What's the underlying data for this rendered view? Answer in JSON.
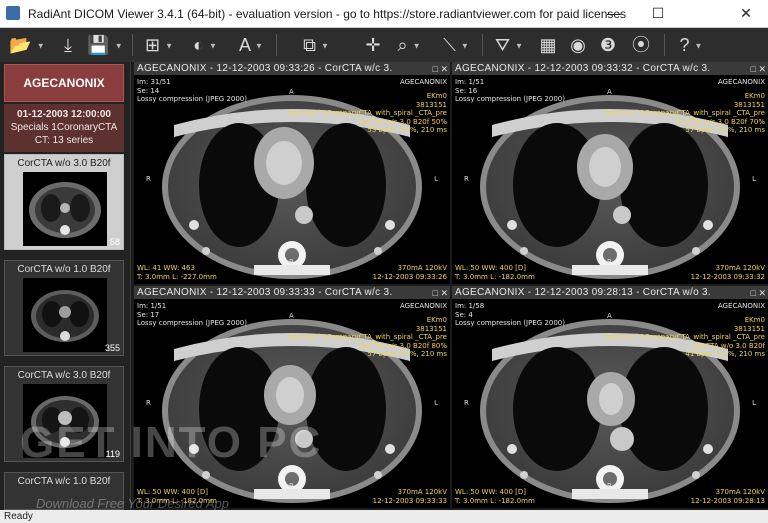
{
  "window": {
    "title": "RadiAnt DICOM Viewer 3.4.1 (64-bit) - evaluation version - go to https://store.radiantviewer.com for paid licenses",
    "minimize": "—",
    "maximize": "☐",
    "close": "✕"
  },
  "toolbar": {
    "items": [
      {
        "name": "open-folder-icon",
        "glyph": "📂"
      },
      {
        "name": "download-icon",
        "glyph": "⤓"
      },
      {
        "name": "save-icon",
        "glyph": "💾"
      },
      {
        "name": "layout-grid-icon",
        "glyph": "⊞"
      },
      {
        "name": "window-level-icon",
        "glyph": "◐"
      },
      {
        "name": "annotation-text-icon",
        "glyph": "A"
      },
      {
        "name": "series-stack-icon",
        "glyph": "⧉"
      },
      {
        "name": "crosshair-icon",
        "glyph": "✛"
      },
      {
        "name": "zoom-icon",
        "glyph": "⌕"
      },
      {
        "name": "measure-icon",
        "glyph": "⟍"
      },
      {
        "name": "mpr-icon",
        "glyph": "⛛"
      },
      {
        "name": "cine-icon",
        "glyph": "▦"
      },
      {
        "name": "3d-mpr-icon",
        "glyph": "◉"
      },
      {
        "name": "3d-volume-icon",
        "glyph": "❸"
      },
      {
        "name": "fusion-icon",
        "glyph": "⦿"
      },
      {
        "name": "help-icon",
        "glyph": "?"
      }
    ]
  },
  "sidebar": {
    "patient_name": "AGECANONIX",
    "study_datetime": "01-12-2003 12:00:00",
    "study_desc": "Specials 1CoronaryCTA",
    "series_count": "CT: 13 series",
    "series": [
      {
        "label": "CorCTA w/o  3.0  B20f",
        "count": "58"
      },
      {
        "label": "CorCTA w/o  1.0  B20f",
        "count": "355"
      },
      {
        "label": "CorCTA w/c  3.0  B20f",
        "count": "119"
      },
      {
        "label": "CorCTA w/c  1.0  B20f",
        "count": ""
      }
    ]
  },
  "viewports": [
    {
      "header": "AGECANONIX - 12-12-2003 09:33:26 - CorCTA w/c 3.",
      "tl": [
        "Im: 31/51",
        "Se: 14",
        "Lossy compression (JPEG 2000)"
      ],
      "tr_white": [
        "AGECANONIX"
      ],
      "tr_yellow": [
        "EKm0",
        "3813151",
        "Specials^1CoronaryCTA_with_spiral _CTA_pre",
        "CorCTA w/c  3.0  B20f  50%",
        "53 bpm, 50 %, 210 ms"
      ],
      "bl": [
        "WL: 41 WW: 463",
        "T: 3.0mm L: -227.0mm"
      ],
      "br": [
        "370mA 120kV",
        "12-12-2003 09:33:26"
      ],
      "orient": {
        "top": "A",
        "left": "R",
        "right": "L",
        "bottom": "P"
      }
    },
    {
      "header": "AGECANONIX - 12-12-2003 09:33:32 - CorCTA w/c 3.",
      "tl": [
        "Im: 1/51",
        "Se: 16",
        "Lossy compression (JPEG 2000)"
      ],
      "tr_white": [
        "AGECANONIX"
      ],
      "tr_yellow": [
        "EKm0",
        "3813151",
        "Specials^1CoronaryCTA_with_spiral _CTA_pre",
        "CorCTA w/c  3.0  B20f  70%",
        "57 bpm, 70 %, 210 ms"
      ],
      "bl": [
        "WL: 50 WW: 400 [D]",
        "T: 3.0mm L: -182.0mm"
      ],
      "br": [
        "370mA 120kV",
        "12-12-2003 09:33:32"
      ],
      "orient": {
        "top": "A",
        "left": "R",
        "right": "L",
        "bottom": "P"
      }
    },
    {
      "header": "AGECANONIX - 12-12-2003 09:33:33 - CorCTA w/c 3.",
      "tl": [
        "Im: 1/51",
        "Se: 17",
        "Lossy compression (JPEG 2000)"
      ],
      "tr_white": [
        "AGECANONIX"
      ],
      "tr_yellow": [
        "EKm0",
        "3813151",
        "Specials^1CoronaryCTA_with_spiral _CTA_pre",
        "CorCTA w/c  3.0  B20f  80%",
        "57 bpm, 80 %, 210 ms"
      ],
      "bl": [
        "WL: 50 WW: 400 [D]",
        "T: 3.0mm L: -182.0mm"
      ],
      "br": [
        "370mA 120kV",
        "12-12-2003 09:33:33"
      ],
      "orient": {
        "top": "A",
        "left": "R",
        "right": "L",
        "bottom": "P"
      }
    },
    {
      "header": "AGECANONIX - 12-12-2003 09:28:13 - CorCTA w/o 3.",
      "tl": [
        "Im: 1/58",
        "Se: 4",
        "Lossy compression (JPEG 2000)"
      ],
      "tr_white": [
        "AGECANONIX"
      ],
      "tr_yellow": [
        "EKm0",
        "3813151",
        "Specials^1CoronaryCTA_with_spiral _CTA_pre",
        "CorCTA w/o  3.0  B20f",
        "41 bpm, 40 %, 210 ms"
      ],
      "bl": [
        "WL: 50 WW: 400 [D]",
        "T: 3.0mm L: -182.0mm"
      ],
      "br": [
        "370mA 120kV",
        "12-12-2003 09:28:13"
      ],
      "orient": {
        "top": "A",
        "left": "R",
        "right": "L",
        "bottom": "P"
      }
    }
  ],
  "viewport_controls": "□ ✕",
  "status": "Ready",
  "watermark": {
    "main": "GET INTO PC",
    "sub": "Download Free Your Desired App"
  }
}
